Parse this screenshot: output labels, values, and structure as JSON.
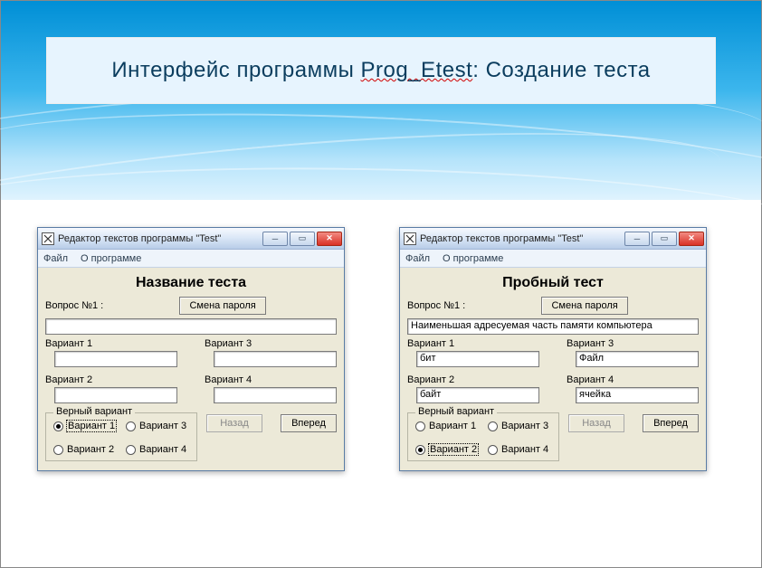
{
  "slide": {
    "title_prefix": "Интерфейс программы ",
    "title_app": "Prog_Etest",
    "title_suffix": ": Создание теста"
  },
  "common": {
    "window_title": "Редактор текстов программы \"Test\"",
    "menu": {
      "file": "Файл",
      "about": "О программе"
    },
    "question_label": "Вопрос №1 :",
    "change_password": "Смена пароля",
    "variant_labels": [
      "Вариант 1",
      "Вариант 2",
      "Вариант 3",
      "Вариант 4"
    ],
    "correct_group": "Верный вариант",
    "radio_labels": [
      "Вариант 1",
      "Вариант 2",
      "Вариант 3",
      "Вариант 4"
    ],
    "back": "Назад",
    "forward": "Вперед"
  },
  "left": {
    "test_title": "Название теста",
    "question": "",
    "variants": [
      "",
      "",
      "",
      ""
    ],
    "selected_radio": 0,
    "back_disabled": true
  },
  "right": {
    "test_title": "Пробный тест",
    "question": "Наименьшая адресуемая часть памяти компьютера",
    "variants": [
      "бит",
      "байт",
      "Файл",
      "ячейка"
    ],
    "selected_radio": 1,
    "back_disabled": true
  }
}
